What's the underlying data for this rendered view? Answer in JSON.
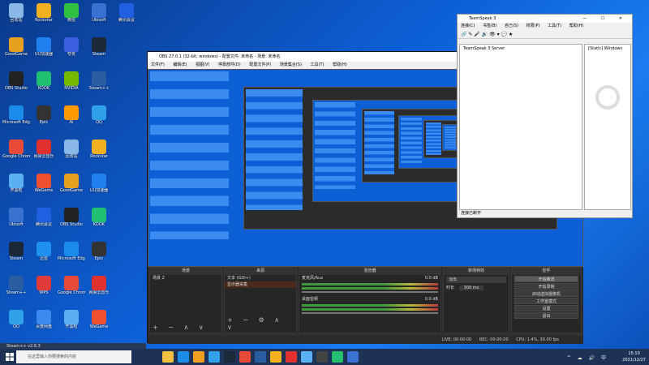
{
  "desktop": {
    "icons": [
      {
        "label": "回收站",
        "color": "#8ab8e8"
      },
      {
        "label": "GoodGame",
        "color": "#e8a020"
      },
      {
        "label": "OBS Studio",
        "color": "#222"
      },
      {
        "label": "Microsoft Edge",
        "color": "#1a8be8"
      },
      {
        "label": "Google Chrome",
        "color": "#e84a3a"
      },
      {
        "label": "开黑啦",
        "color": "#5ab0f0"
      },
      {
        "label": "Ubisoft",
        "color": "#3a70d0"
      },
      {
        "label": "Steam",
        "color": "#1b2838"
      },
      {
        "label": "Steam++",
        "color": "#2a5ea0"
      },
      {
        "label": "QQ",
        "color": "#30a0e8"
      },
      {
        "label": "Rockstar",
        "color": "#f0b020"
      },
      {
        "label": "UU加速器",
        "color": "#2080f0"
      },
      {
        "label": "KOOK",
        "color": "#20c070"
      },
      {
        "label": "Epic",
        "color": "#333"
      },
      {
        "label": "网易云音乐",
        "color": "#e03030"
      },
      {
        "label": "WeGame",
        "color": "#f05030"
      },
      {
        "label": "腾讯会议",
        "color": "#2060e0"
      },
      {
        "label": "迅雷",
        "color": "#2090f0"
      },
      {
        "label": "WPS",
        "color": "#e03a3a"
      },
      {
        "label": "百度网盘",
        "color": "#3a8af0"
      },
      {
        "label": "微信",
        "color": "#30c040"
      },
      {
        "label": "夸克",
        "color": "#3a60e0"
      },
      {
        "label": "NVIDIA",
        "color": "#76b900"
      },
      {
        "label": "Ai",
        "color": "#ff9a00"
      }
    ]
  },
  "obs": {
    "title": "OBS 27.0.1 (32-bit, windows) - 配置文件: 未命名 - 场景: 未命名",
    "menu": [
      "文件(F)",
      "编辑(E)",
      "视图(V)",
      "停靠部件(D)",
      "配置文件(P)",
      "场景集合(S)",
      "工具(T)",
      "帮助(H)"
    ],
    "docks": {
      "scenes": {
        "title": "场景",
        "items": [
          "场景 2"
        ]
      },
      "sources": {
        "title": "来源",
        "items": [
          "文本 (GDI+)",
          "显示器采集"
        ]
      },
      "mixer": {
        "title": "混音器",
        "channels": [
          {
            "name": "麦克风/Aux",
            "level": "0.0 dB"
          },
          {
            "name": "桌面音频",
            "level": "0.0 dB"
          }
        ]
      },
      "transitions": {
        "title": "转场特效",
        "type": "淡出",
        "duration_label": "时长",
        "duration": "300 ms"
      },
      "controls": {
        "title": "控件",
        "buttons": [
          "开始推流",
          "开始录制",
          "启动虚拟摄像机",
          "工作室模式",
          "设置",
          "退出"
        ]
      }
    },
    "status": {
      "live": "LIVE: 00:00:00",
      "rec": "REC: 00:00:00",
      "cpu": "CPU: 1.4%, 30.00 fps"
    },
    "nested_scene_label": "未命名场景"
  },
  "gamewin": {
    "title": "TeamSpeak 3",
    "menu": [
      "连接(C)",
      "书签(B)",
      "自己(S)",
      "权限(P)",
      "工具(T)",
      "帮助(H)"
    ],
    "list_header": "TeamSpeak 3 Server",
    "side_label": "[Static] Windows",
    "status": "连接已断开"
  },
  "taskbar": {
    "search_placeholder": "在这里输入你要搜索的内容",
    "time": "15:10",
    "date": "2021/12/27",
    "lang": "中",
    "steam_bar": "Steam++ v2.6.3"
  }
}
